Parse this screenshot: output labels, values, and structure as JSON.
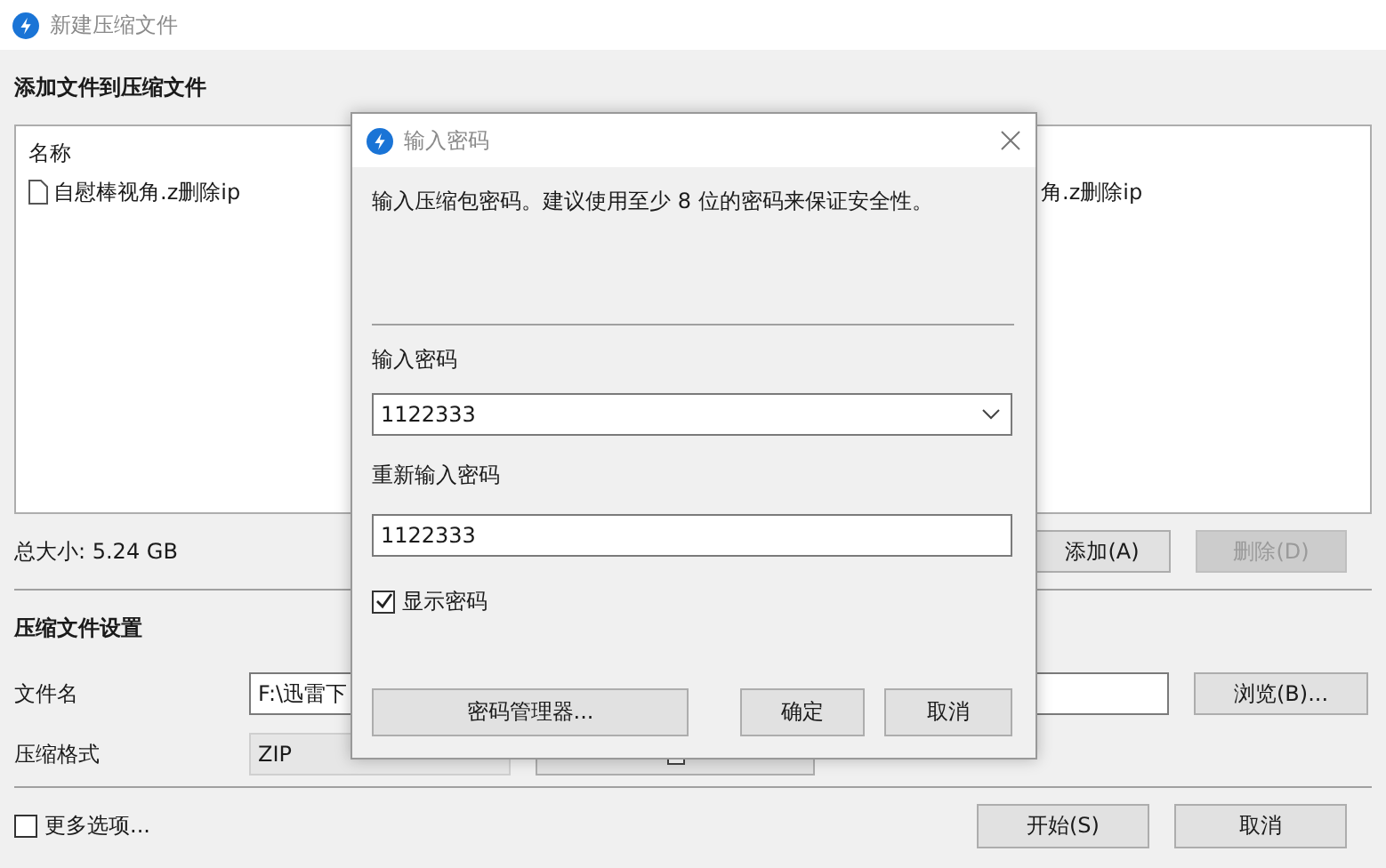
{
  "window": {
    "title": "新建压缩文件"
  },
  "add_section": {
    "heading": "添加文件到压缩文件",
    "file_list": {
      "columns": [
        "名称"
      ],
      "rows": [
        {
          "name": "自慰棒视角.z删除ip",
          "column_2": "角.z删除ip"
        }
      ]
    },
    "total_size": "总大小: 5.24 GB",
    "buttons": [
      {
        "label": "添加(A)",
        "disabled": false
      },
      {
        "label": "删除(D)",
        "disabled": true
      }
    ]
  },
  "settings": {
    "heading": "压缩文件设置",
    "file_name": {
      "label": "文件名",
      "value": "F:\\迅雷下"
    },
    "browse_button": "浏览(B)...",
    "format": {
      "label": "压缩格式",
      "value": "ZIP"
    }
  },
  "more_options": {
    "label": "更多选项...",
    "checked": false
  },
  "footer_buttons": [
    "开始(S)",
    "取消"
  ],
  "dialog": {
    "title": "输入密码",
    "message": "输入压缩包密码。建议使用至少 8 位的密码来保证安全性。",
    "password": {
      "label": "输入密码",
      "value": "1122333"
    },
    "confirm": {
      "label": "重新输入密码",
      "value": "1122333"
    },
    "show_password": {
      "label": "显示密码",
      "checked": true
    },
    "buttons": [
      "密码管理器...",
      "确定",
      "取消"
    ]
  }
}
